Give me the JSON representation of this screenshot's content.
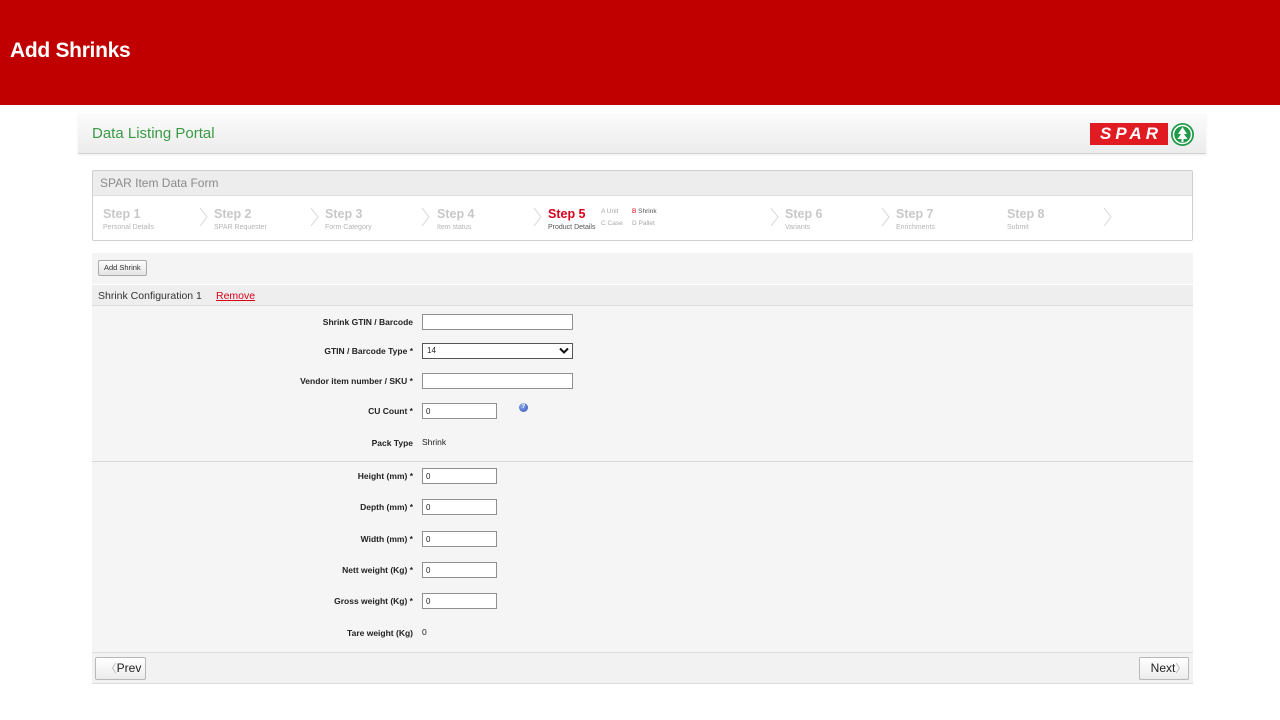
{
  "banner": {
    "title": "Add Shrinks"
  },
  "portal": {
    "title": "Data Listing Portal",
    "logo_text": "SPAR"
  },
  "form": {
    "title": "SPAR Item Data Form",
    "steps": [
      {
        "name": "Step 1",
        "sub": "Personal Details"
      },
      {
        "name": "Step 2",
        "sub": "SPAR Requester"
      },
      {
        "name": "Step 3",
        "sub": "Form Category"
      },
      {
        "name": "Step 4",
        "sub": "Item status"
      },
      {
        "name": "Step 5",
        "sub": "Product Details"
      },
      {
        "name": "Step 6",
        "sub": "Variants"
      },
      {
        "name": "Step 7",
        "sub": "Enrichments"
      },
      {
        "name": "Step 8",
        "sub": "Submit"
      }
    ],
    "active_step": "Step 5",
    "substeps": [
      {
        "letter": "A",
        "label": "Unit"
      },
      {
        "letter": "B",
        "label": "Shrink"
      },
      {
        "letter": "C",
        "label": "Case"
      },
      {
        "letter": "D",
        "label": "Pallet"
      }
    ],
    "active_substep": "B"
  },
  "actions": {
    "add_shrink_label": "Add Shrink"
  },
  "config": {
    "title": "Shrink Configuration 1",
    "remove_label": "Remove"
  },
  "fields": {
    "gtin": {
      "label": "Shrink GTIN / Barcode",
      "value": ""
    },
    "gtin_type": {
      "label": "GTIN / Barcode Type *",
      "value": "14"
    },
    "vendor_sku": {
      "label": "Vendor item number / SKU *",
      "value": ""
    },
    "cu_count": {
      "label": "CU Count *",
      "value": "0"
    },
    "pack_type": {
      "label": "Pack Type",
      "value": "Shrink"
    },
    "height": {
      "label": "Height (mm) *",
      "value": "0"
    },
    "depth": {
      "label": "Depth (mm) *",
      "value": "0"
    },
    "width": {
      "label": "Width (mm) *",
      "value": "0"
    },
    "nett_weight": {
      "label": "Nett weight (Kg) *",
      "value": "0"
    },
    "gross_weight": {
      "label": "Gross weight (Kg) *",
      "value": "0"
    },
    "tare_weight": {
      "label": "Tare weight (Kg)",
      "value": "0"
    }
  },
  "nav": {
    "prev_label": "Prev",
    "next_label": "Next"
  },
  "colors": {
    "banner": "#c00000",
    "accent_green": "#3a9a45",
    "active_red": "#d9001b",
    "spar_red": "#e11b22",
    "spar_green": "#1f9a48"
  }
}
